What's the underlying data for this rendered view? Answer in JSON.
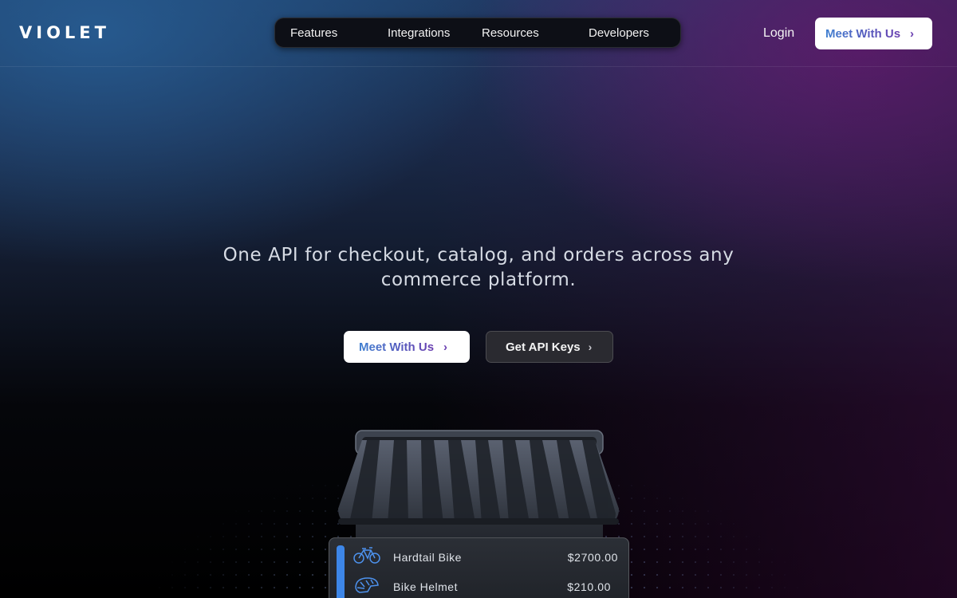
{
  "brand": {
    "logo_text": "VIOLET"
  },
  "nav": {
    "items": [
      {
        "label": "Features"
      },
      {
        "label": "Integrations"
      },
      {
        "label": "Resources"
      },
      {
        "label": "Developers"
      }
    ],
    "login_label": "Login",
    "meet_label": "Meet With Us"
  },
  "hero": {
    "headline": "One API for checkout, catalog, and orders across any commerce platform.",
    "primary_cta": "Meet With Us",
    "secondary_cta": "Get API Keys"
  },
  "storefront": {
    "products": [
      {
        "name": "Hardtail Bike",
        "price": "$2700.00",
        "icon": "bicycle-icon"
      },
      {
        "name": "Bike Helmet",
        "price": "$210.00",
        "icon": "helmet-icon"
      }
    ]
  },
  "colors": {
    "accent_blue": "#3f7fd0",
    "accent_purple": "#6a3fb0",
    "card_bar": "#3d86e8"
  }
}
